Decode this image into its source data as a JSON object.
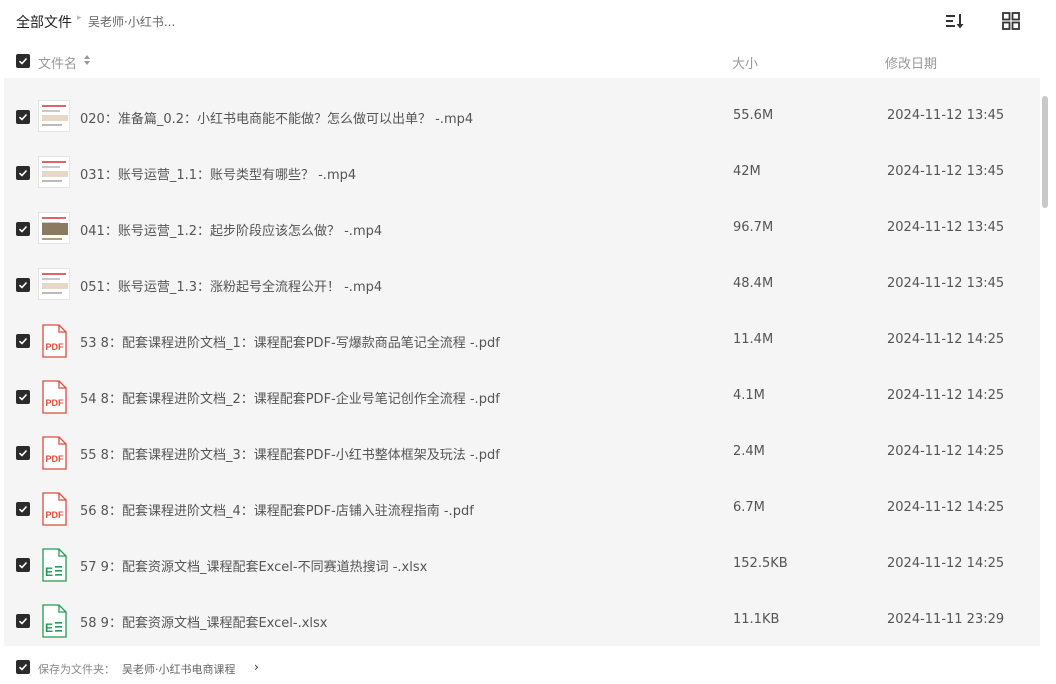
{
  "breadcrumb": {
    "root": "全部文件",
    "separator": "▸",
    "current": "吴老师·小红书..."
  },
  "toolbar": {
    "sort_icon": "sort-list-icon",
    "view_icon": "grid-view-icon"
  },
  "columns": {
    "name": "文件名",
    "size": "大小",
    "modified": "修改日期"
  },
  "rows": [
    {
      "name": "020：准备篇_0.2：小红书电商能不能做？怎么做可以出单？ -.mp4",
      "size": "55.6M",
      "date": "2024-11-12 13:45",
      "type": "video",
      "checked": true
    },
    {
      "name": "031：账号运营_1.1：账号类型有哪些？ -.mp4",
      "size": "42M",
      "date": "2024-11-12 13:45",
      "type": "video",
      "checked": true
    },
    {
      "name": "041：账号运营_1.2：起步阶段应该怎么做？ -.mp4",
      "size": "96.7M",
      "date": "2024-11-12 13:45",
      "type": "video",
      "checked": true
    },
    {
      "name": "051：账号运营_1.3：涨粉起号全流程公开！ -.mp4",
      "size": "48.4M",
      "date": "2024-11-12 13:45",
      "type": "video",
      "checked": true
    },
    {
      "name": "53 8：配套课程进阶文档_1：课程配套PDF-写爆款商品笔记全流程 -.pdf",
      "size": "11.4M",
      "date": "2024-11-12 14:25",
      "type": "pdf",
      "checked": true
    },
    {
      "name": "54 8：配套课程进阶文档_2：课程配套PDF-企业号笔记创作全流程 -.pdf",
      "size": "4.1M",
      "date": "2024-11-12 14:25",
      "type": "pdf",
      "checked": true
    },
    {
      "name": "55 8：配套课程进阶文档_3：课程配套PDF-小红书整体框架及玩法 -.pdf",
      "size": "2.4M",
      "date": "2024-11-12 14:25",
      "type": "pdf",
      "checked": true
    },
    {
      "name": "56 8：配套课程进阶文档_4：课程配套PDF-店铺入驻流程指南 -.pdf",
      "size": "6.7M",
      "date": "2024-11-12 14:25",
      "type": "pdf",
      "checked": true
    },
    {
      "name": "57 9：配套资源文档_课程配套Excel-不同赛道热搜词 -.xlsx",
      "size": "152.5KB",
      "date": "2024-11-12 14:25",
      "type": "excel",
      "checked": true
    },
    {
      "name": "58 9：配套资源文档_课程配套Excel-.xlsx",
      "size": "11.1KB",
      "date": "2024-11-11 23:29",
      "type": "excel",
      "checked": true
    }
  ],
  "file_icons": {
    "pdf_label": "PDF",
    "excel_label": "E"
  },
  "footer": {
    "label": "保存为文件夹：",
    "path": "吴老师·小红书电商课程",
    "arrow": "›"
  },
  "colors": {
    "checkbox": "#2b2b2b",
    "list_bg": "#f5f5f5",
    "pdf_red": "#e04b3a",
    "excel_green": "#1f9d55"
  }
}
